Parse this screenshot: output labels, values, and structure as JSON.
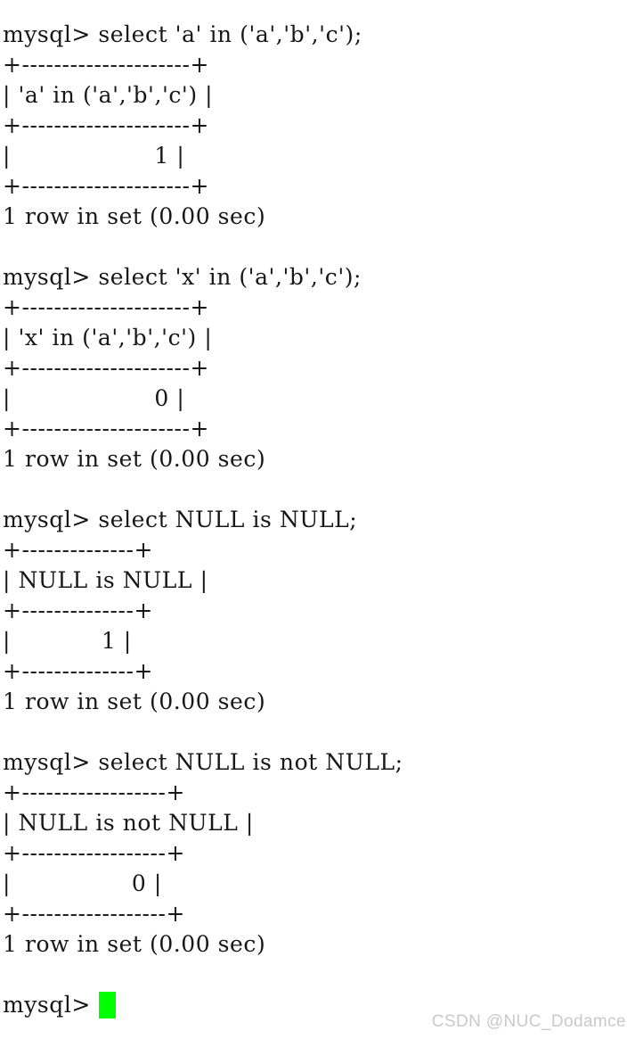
{
  "terminal": {
    "title": "mysql client session",
    "background_color": "#ffffff",
    "text_color": "#171717",
    "cursor_color": "#00ff00",
    "blocks": [
      {
        "id": "block-in-a",
        "command": "mysql> select 'a' in ('a','b','c');",
        "table": {
          "top_border": "+---------------------+",
          "header_row": "| 'a' in ('a','b','c') |",
          "mid_border": "+---------------------+",
          "value_row": "|                   1 |",
          "bottom_border": "+---------------------+",
          "column_header": "'a' in ('a','b','c')",
          "value": "1"
        },
        "status": "1 row in set (0.00 sec)"
      },
      {
        "id": "block-in-x",
        "command": "mysql> select 'x' in ('a','b','c');",
        "table": {
          "top_border": "+---------------------+",
          "header_row": "| 'x' in ('a','b','c') |",
          "mid_border": "+---------------------+",
          "value_row": "|                   0 |",
          "bottom_border": "+---------------------+",
          "column_header": "'x' in ('a','b','c')",
          "value": "0"
        },
        "status": "1 row in set (0.00 sec)"
      },
      {
        "id": "block-is-null",
        "command": "mysql> select NULL is NULL;",
        "table": {
          "top_border": "+--------------+",
          "header_row": "| NULL is NULL |",
          "mid_border": "+--------------+",
          "value_row": "|            1 |",
          "bottom_border": "+--------------+",
          "column_header": "NULL is NULL",
          "value": "1"
        },
        "status": "1 row in set (0.00 sec)"
      },
      {
        "id": "block-is-not-null",
        "command": "mysql> select NULL is not NULL;",
        "table": {
          "top_border": "+------------------+",
          "header_row": "| NULL is not NULL |",
          "mid_border": "+------------------+",
          "value_row": "|                0 |",
          "bottom_border": "+------------------+",
          "column_header": "NULL is not NULL",
          "value": "0"
        },
        "status": "1 row in set (0.00 sec)"
      }
    ],
    "final_prompt": "mysql> "
  },
  "watermark": {
    "text": "CSDN @NUC_Dodamce",
    "color": "#c9c9c9"
  }
}
